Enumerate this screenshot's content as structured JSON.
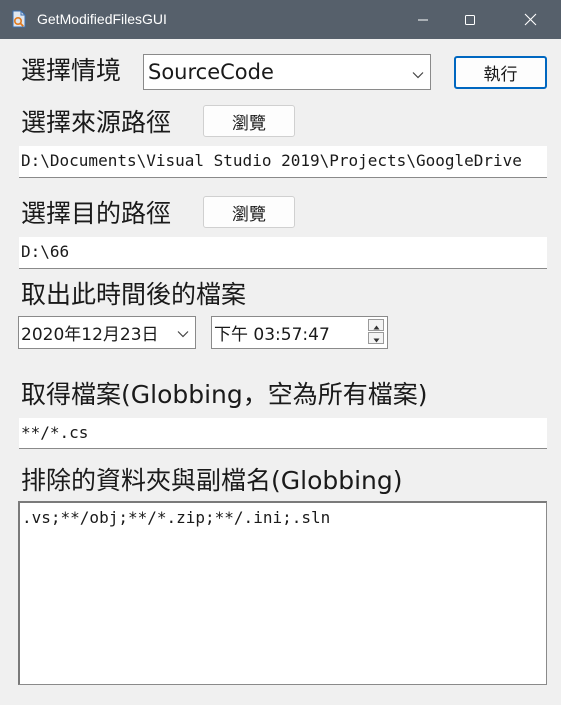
{
  "window": {
    "title": "GetModifiedFilesGUI",
    "titlebar_color": "#56606b"
  },
  "scenario": {
    "label": "選擇情境",
    "selected": "SourceCode",
    "run_button": "執行"
  },
  "source": {
    "label": "選擇來源路徑",
    "browse_button": "瀏覽",
    "path": "D:\\Documents\\Visual Studio 2019\\Projects\\GoogleDrive"
  },
  "destination": {
    "label": "選擇目的路徑",
    "browse_button": "瀏覽",
    "path": "D:\\66"
  },
  "modified_after": {
    "label": "取出此時間後的檔案",
    "date": "2020年12月23日",
    "time": "下午 03:57:47"
  },
  "include": {
    "label": "取得檔案(Globbing，空為所有檔案)",
    "pattern": "**/*.cs"
  },
  "exclude": {
    "label": "排除的資料夾與副檔名(Globbing)",
    "patterns": ".vs;**/obj;**/*.zip;**/.ini;.sln"
  },
  "icons": {
    "app": "app-icon",
    "minimize": "minimize-icon",
    "maximize": "maximize-icon",
    "close": "close-icon",
    "dropdown": "chevron-down-icon",
    "spin_up": "spin-up-icon",
    "spin_down": "spin-down-icon"
  }
}
